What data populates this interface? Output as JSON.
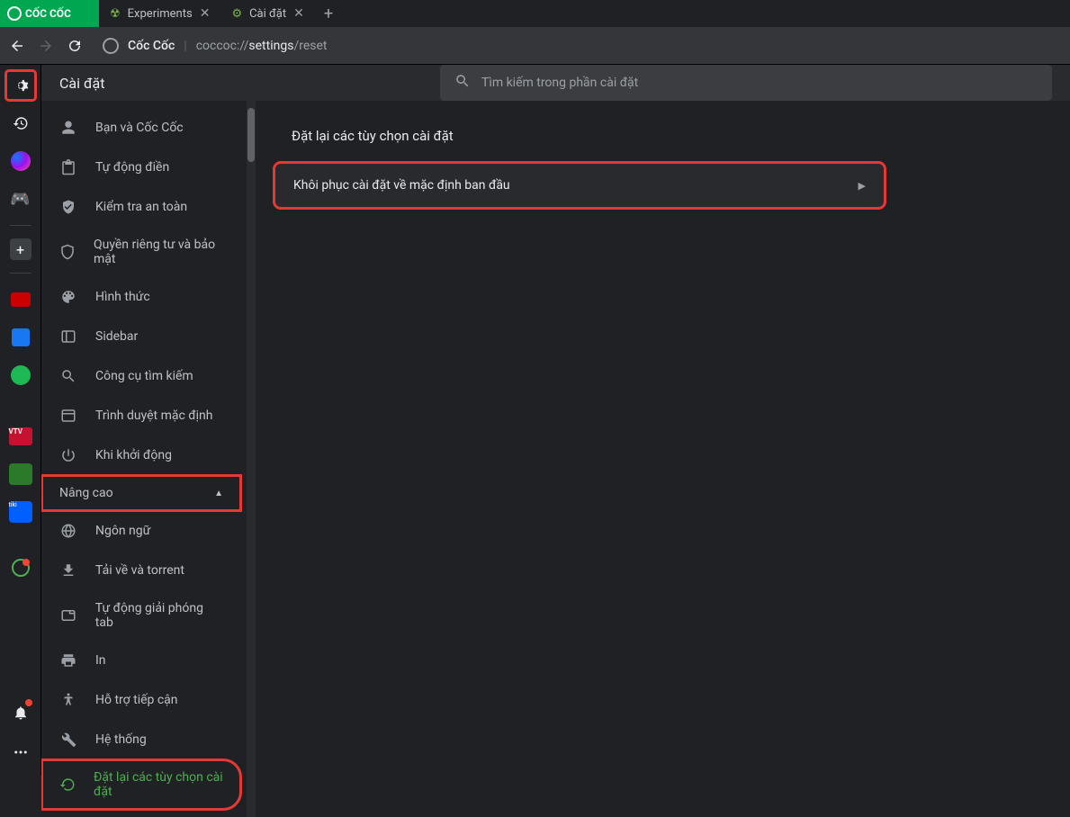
{
  "browser": {
    "logo": "CỐC CỐC",
    "tabs": [
      {
        "label": "Experiments",
        "icon": "radiation"
      },
      {
        "label": "Cài đặt",
        "icon": "gear"
      }
    ],
    "brand": "Cốc Cốc",
    "url_prefix": "coccoc://",
    "url_highlight": "settings",
    "url_suffix": "/reset"
  },
  "settings": {
    "title": "Cài đặt",
    "search_placeholder": "Tìm kiếm trong phần cài đặt",
    "nav": [
      {
        "icon": "person",
        "label": "Bạn và Cốc Cốc"
      },
      {
        "icon": "clipboard",
        "label": "Tự động điền"
      },
      {
        "icon": "shield-check",
        "label": "Kiểm tra an toàn"
      },
      {
        "icon": "shield",
        "label": "Quyền riêng tư và bảo mật"
      },
      {
        "icon": "palette",
        "label": "Hình thức"
      },
      {
        "icon": "window",
        "label": "Sidebar"
      },
      {
        "icon": "search",
        "label": "Công cụ tìm kiếm"
      },
      {
        "icon": "browser",
        "label": "Trình duyệt mặc định"
      },
      {
        "icon": "power",
        "label": "Khi khởi động"
      }
    ],
    "advanced_label": "Nâng cao",
    "advanced_nav": [
      {
        "icon": "globe",
        "label": "Ngôn ngữ"
      },
      {
        "icon": "download",
        "label": "Tải về và torrent"
      },
      {
        "icon": "tab",
        "label": "Tự động giải phóng tab"
      },
      {
        "icon": "print",
        "label": "In"
      },
      {
        "icon": "accessibility",
        "label": "Hỗ trợ tiếp cận"
      },
      {
        "icon": "wrench",
        "label": "Hệ thống"
      },
      {
        "icon": "restore",
        "label": "Đặt lại các tùy chọn cài đặt",
        "active": true
      }
    ],
    "content": {
      "title": "Đặt lại các tùy chọn cài đặt",
      "card_label": "Khôi phục cài đặt về mặc định ban đầu"
    }
  }
}
